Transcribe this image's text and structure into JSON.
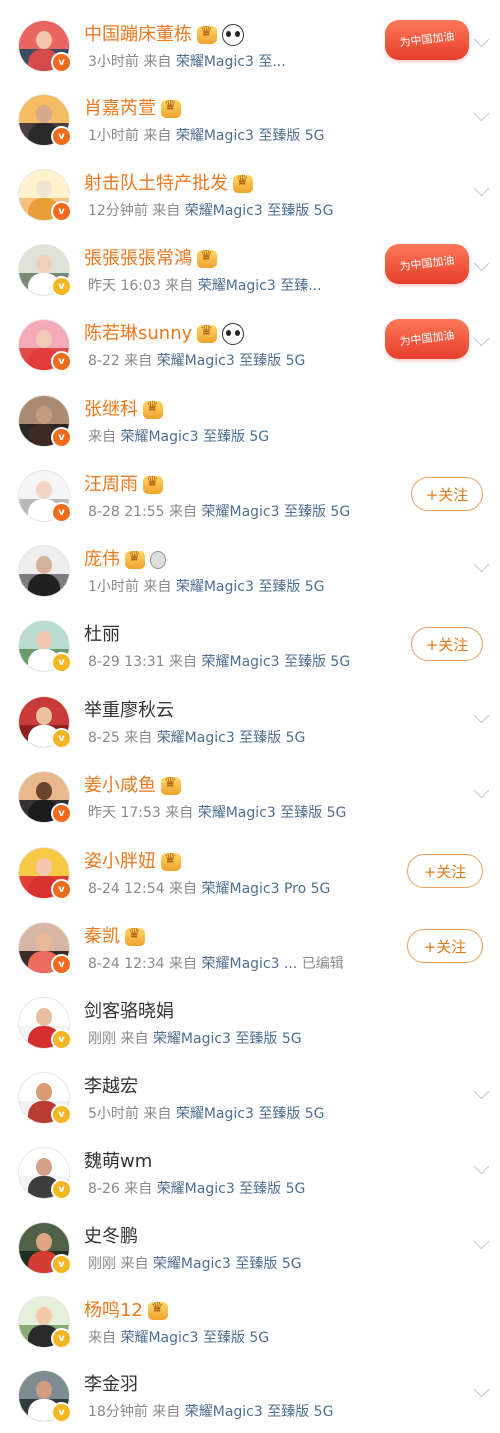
{
  "feed": {
    "items": [
      {
        "name": "中国蹦床董栋",
        "vip": true,
        "icons": [
          "crown",
          "panda"
        ],
        "meta": "3小时前",
        "from": "来自",
        "source": "荣耀Magic3 至...",
        "badge": "orange",
        "action": "cheer",
        "cheer_text": "为中国加油",
        "avatar_colors": [
          "#e86561",
          "#384d5f",
          "#f0c8b0",
          "#d44b4b"
        ]
      },
      {
        "name": "肖嘉芮萱",
        "vip": true,
        "icons": [
          "crown"
        ],
        "meta": "1小时前",
        "from": "来自",
        "source": "荣耀Magic3 至臻版 5G",
        "badge": "orange",
        "action": "chevron",
        "avatar_colors": [
          "#f6bc64",
          "#4a4040",
          "#d5a98a",
          "#2a2a2a"
        ]
      },
      {
        "name": "射击队土特产批发",
        "vip": true,
        "icons": [
          "crown"
        ],
        "meta": "12分钟前",
        "from": "来自",
        "source": "荣耀Magic3 至臻版 5G",
        "badge": "orange",
        "action": "chevron",
        "avatar_colors": [
          "#fff2cc",
          "#f3c07e",
          "#f0e6d0",
          "#e99f38"
        ]
      },
      {
        "name": "張張張張常鴻",
        "vip": true,
        "icons": [
          "crown"
        ],
        "meta": "昨天 16:03",
        "from": "来自",
        "source": "荣耀Magic3 至臻...",
        "badge": "gold",
        "action": "cheer",
        "cheer_text": "为中国加油",
        "avatar_colors": [
          "#dfe2d6",
          "#7a8876",
          "#f0d0b8",
          "#ffffff"
        ]
      },
      {
        "name": "陈若琳sunny",
        "vip": true,
        "icons": [
          "crown",
          "panda"
        ],
        "meta": "8-22",
        "from": "来自",
        "source": "荣耀Magic3 至臻版 5G",
        "badge": "orange",
        "action": "cheer",
        "cheer_text": "为中国加油",
        "avatar_colors": [
          "#f4aab9",
          "#de4b4b",
          "#f2cbb4",
          "#e33b3b"
        ]
      },
      {
        "name": "张继科",
        "vip": true,
        "icons": [
          "crown"
        ],
        "meta": "",
        "from": "来自",
        "source": "荣耀Magic3 至臻版 5G",
        "badge": "orange",
        "action": "none",
        "avatar_colors": [
          "#aa8b75",
          "#2e2523",
          "#c59b7f",
          "#3a2a22"
        ]
      },
      {
        "name": "汪周雨",
        "vip": true,
        "icons": [
          "crown"
        ],
        "meta": "8-28 21:55",
        "from": "来自",
        "source": "荣耀Magic3 至臻版 5G",
        "badge": "orange",
        "action": "follow",
        "follow_text": "+关注",
        "avatar_colors": [
          "#f5f5f5",
          "#b8b8b8",
          "#f2d5c2",
          "#ffffff"
        ]
      },
      {
        "name": "庞伟",
        "vip": true,
        "icons": [
          "crown",
          "medal"
        ],
        "meta": "1小时前",
        "from": "来自",
        "source": "荣耀Magic3 至臻版 5G",
        "badge": "none",
        "action": "chevron",
        "avatar_colors": [
          "#eeeeee",
          "#7e7e7e",
          "#d4b39a",
          "#202020"
        ]
      },
      {
        "name": "杜丽",
        "vip": false,
        "icons": [],
        "meta": "8-29 13:31",
        "from": "来自",
        "source": "荣耀Magic3 至臻版 5G",
        "badge": "gold",
        "action": "follow",
        "follow_text": "+关注",
        "avatar_colors": [
          "#b9dbd1",
          "#699c6a",
          "#efc5ad",
          "#ffffff"
        ]
      },
      {
        "name": "举重廖秋云",
        "vip": false,
        "icons": [],
        "meta": "8-25",
        "from": "来自",
        "source": "荣耀Magic3 至臻版 5G",
        "badge": "gold",
        "action": "chevron",
        "avatar_colors": [
          "#c93a3a",
          "#8f1f1f",
          "#eac0a1",
          "#ffffff"
        ]
      },
      {
        "name": "姜小咸鱼",
        "vip": true,
        "icons": [
          "crown"
        ],
        "meta": "昨天 17:53",
        "from": "来自",
        "source": "荣耀Magic3 至臻版 5G",
        "badge": "orange",
        "action": "chevron",
        "avatar_colors": [
          "#eab88e",
          "#343034",
          "#69432c",
          "#1b1b1b"
        ]
      },
      {
        "name": "姿小胖妞",
        "vip": true,
        "icons": [
          "crown"
        ],
        "meta": "8-24 12:54",
        "from": "来自",
        "source": "荣耀Magic3 Pro 5G",
        "badge": "orange",
        "action": "follow",
        "follow_text": "+关注",
        "avatar_colors": [
          "#f7c947",
          "#e33e36",
          "#f4c8b0",
          "#d93030"
        ]
      },
      {
        "name": "秦凯",
        "vip": true,
        "icons": [
          "crown"
        ],
        "meta": "8-24 12:34",
        "from": "来自",
        "source": "荣耀Magic3 ...",
        "edited": "已编辑",
        "badge": "orange",
        "action": "follow",
        "follow_text": "+关注",
        "avatar_colors": [
          "#d8b6a5",
          "#3b2c29",
          "#e8b89b",
          "#eb6b5f"
        ]
      },
      {
        "name": "剑客骆晓娟",
        "vip": false,
        "icons": [],
        "meta": "刚刚",
        "from": "来自",
        "source": "荣耀Magic3 至臻版 5G",
        "badge": "gold",
        "action": "none",
        "avatar_colors": [
          "#ffffff",
          "#f4f4f4",
          "#e7bd9f",
          "#d42f2f"
        ]
      },
      {
        "name": "李越宏",
        "vip": false,
        "icons": [],
        "meta": "5小时前",
        "from": "来自",
        "source": "荣耀Magic3 至臻版 5G",
        "badge": "gold",
        "action": "chevron",
        "avatar_colors": [
          "#ffffff",
          "#f1f1f1",
          "#d89b76",
          "#b93b32"
        ]
      },
      {
        "name": "魏萌wm",
        "vip": false,
        "icons": [],
        "meta": "8-26",
        "from": "来自",
        "source": "荣耀Magic3 至臻版 5G",
        "badge": "gold",
        "action": "chevron",
        "avatar_colors": [
          "#ffffff",
          "#f3f3f3",
          "#d2a288",
          "#3d3d3d"
        ]
      },
      {
        "name": "史冬鹏",
        "vip": false,
        "icons": [],
        "meta": "刚刚",
        "from": "来自",
        "source": "荣耀Magic3 至臻版 5G",
        "badge": "gold",
        "action": "chevron",
        "avatar_colors": [
          "#4f6146",
          "#1f2e22",
          "#e0a684",
          "#d33c33"
        ]
      },
      {
        "name": "杨鸣12",
        "vip": true,
        "icons": [
          "crown"
        ],
        "meta": "",
        "from": "来自",
        "source": "荣耀Magic3 至臻版 5G",
        "badge": "gold",
        "action": "none",
        "avatar_colors": [
          "#e6f0dd",
          "#86ab74",
          "#f1c9a6",
          "#2a2a2a"
        ]
      },
      {
        "name": "李金羽",
        "vip": false,
        "icons": [],
        "meta": "18分钟前",
        "from": "来自",
        "source": "荣耀Magic3 至臻版 5G",
        "badge": "gold",
        "action": "chevron",
        "avatar_colors": [
          "#7f8c92",
          "#2f3a3f",
          "#cf9d80",
          "#ffffff"
        ]
      }
    ]
  }
}
